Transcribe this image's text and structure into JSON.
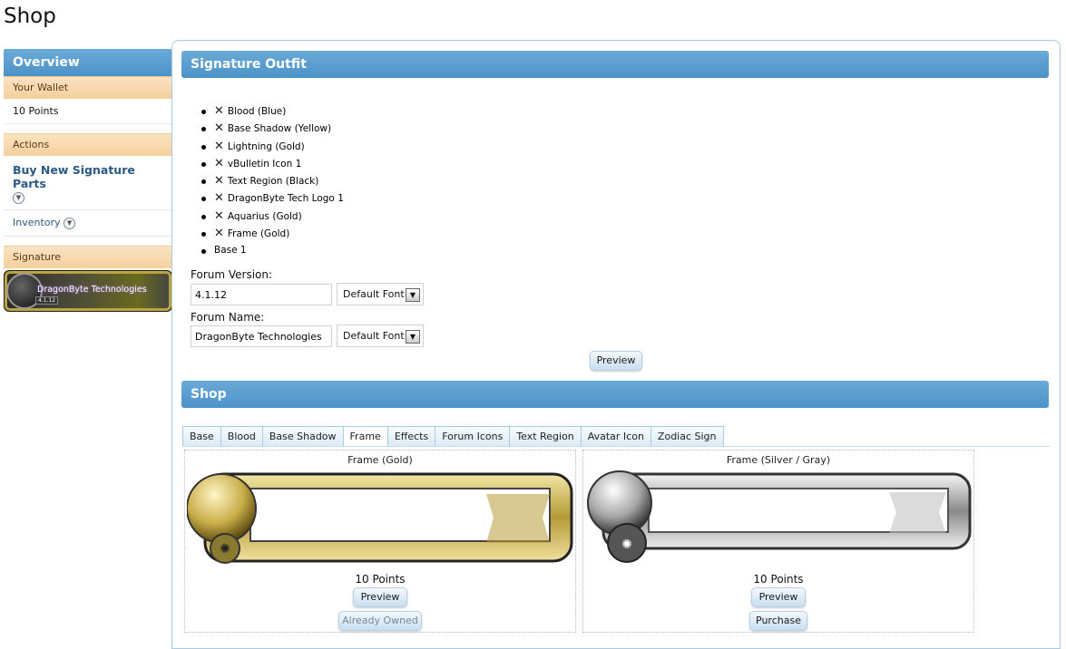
{
  "page": {
    "title": "Shop"
  },
  "sidebar": {
    "header": "Overview",
    "wallet_label": "Your Wallet",
    "wallet_value": "10 Points",
    "actions_label": "Actions",
    "buy_link": "Buy New Signature Parts",
    "inventory_link": "Inventory",
    "signature_label": "Signature",
    "signature_text": "DragonByte Technologies",
    "signature_version": "4.1.12"
  },
  "outfit": {
    "header": "Signature Outfit",
    "items": [
      "Blood (Blue)",
      "Base Shadow (Yellow)",
      "Lightning (Gold)",
      "vBulletin Icon 1",
      "Text Region (Black)",
      "DragonByte Tech Logo 1",
      "Aquarius (Gold)",
      "Frame (Gold)",
      "Base 1"
    ],
    "version_label": "Forum Version:",
    "version_value": "4.1.12",
    "name_label": "Forum Name:",
    "name_value": "DragonByte Technologies",
    "font_option": "Default Font",
    "preview_button": "Preview"
  },
  "shop": {
    "header": "Shop",
    "tabs": [
      "Base",
      "Blood",
      "Base Shadow",
      "Frame",
      "Effects",
      "Forum Icons",
      "Text Region",
      "Avatar Icon",
      "Zodiac Sign"
    ],
    "active_tab": "Frame",
    "items": [
      {
        "title": "Frame (Gold)",
        "price": "10 Points",
        "preview": "Preview",
        "action": "Already Owned"
      },
      {
        "title": "Frame (Silver / Gray)",
        "price": "10 Points",
        "preview": "Preview",
        "action": "Purchase"
      }
    ]
  },
  "colors": {
    "bar_blue": "#5a9fd4",
    "wallet_orange": "#f8d8ad",
    "gold": "#d6c25a",
    "silver": "#b5b5b5"
  },
  "icons": {
    "remove": "close-icon",
    "expand": "chevron-down-icon",
    "dropdown": "dropdown-arrow-icon"
  }
}
